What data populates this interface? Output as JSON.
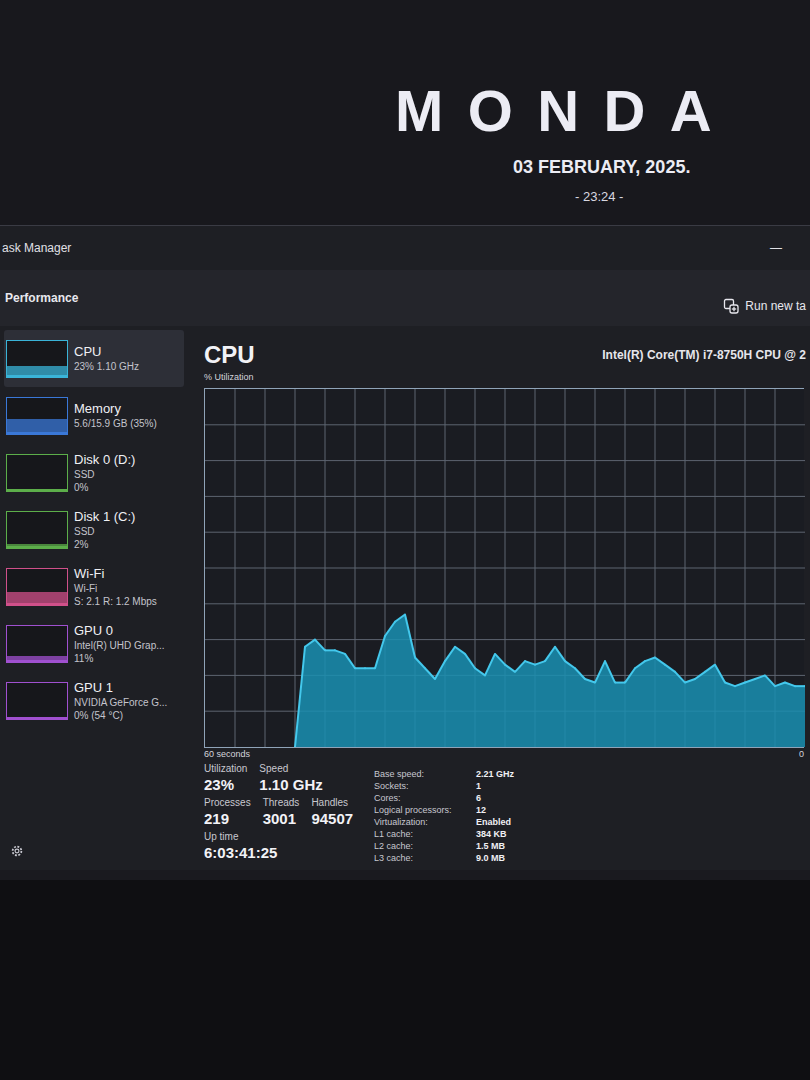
{
  "wallpaper": {
    "day": "MONDA",
    "date": "03 FEBRUARY, 2025.",
    "time": "- 23:24 -"
  },
  "window": {
    "title": "ask Manager",
    "minimize": "—"
  },
  "header": {
    "title": "Performance",
    "action": "Run new ta"
  },
  "sidebar": {
    "items": [
      {
        "name": "CPU",
        "details": [
          "23% 1.10 GHz"
        ],
        "selected": true,
        "level": 0.23,
        "color": "#3ab4d8"
      },
      {
        "name": "Memory",
        "details": [
          "5.6/15.9 GB (35%)"
        ],
        "selected": false,
        "level": 0.35,
        "color": "#3a78d8"
      },
      {
        "name": "Disk 0 (D:)",
        "details": [
          "SSD",
          "0%"
        ],
        "selected": false,
        "level": 0,
        "color": "#5cae4a"
      },
      {
        "name": "Disk 1 (C:)",
        "details": [
          "SSD",
          "2%"
        ],
        "selected": false,
        "level": 0.04,
        "color": "#5cae4a"
      },
      {
        "name": "Wi-Fi",
        "details": [
          "Wi-Fi",
          "S: 2.1 R: 1.2 Mbps"
        ],
        "selected": false,
        "level": 0.3,
        "color": "#d0508a"
      },
      {
        "name": "GPU 0",
        "details": [
          "Intel(R) UHD Grap...",
          "11%"
        ],
        "selected": false,
        "level": 0.11,
        "color": "#a050d0"
      },
      {
        "name": "GPU 1",
        "details": [
          "NVIDIA GeForce G...",
          "0% (54 °C)"
        ],
        "selected": false,
        "level": 0,
        "color": "#a050d0"
      }
    ]
  },
  "main": {
    "title": "CPU",
    "processor": "Intel(R) Core(TM) i7-8750H CPU @ 2",
    "axis_label": "% Utilization",
    "x_start": "60 seconds",
    "x_end": "0",
    "chart": {
      "max": 100,
      "values": [
        0,
        28,
        30,
        27,
        27,
        26,
        22,
        22,
        22,
        31,
        35,
        37,
        25,
        22,
        19,
        24,
        28,
        26,
        22,
        20,
        26,
        23,
        21,
        24,
        23,
        24,
        28,
        24,
        22,
        19,
        18,
        24,
        18,
        18,
        22,
        24,
        25,
        23,
        21,
        18,
        19,
        21,
        23,
        18,
        17,
        18,
        19,
        20,
        17,
        18,
        17,
        17
      ]
    }
  },
  "stats": [
    [
      {
        "label": "Utilization",
        "value": "23%"
      },
      {
        "label": "Speed",
        "value": "1.10 GHz"
      }
    ],
    [
      {
        "label": "Processes",
        "value": "219"
      },
      {
        "label": "Threads",
        "value": "3001"
      },
      {
        "label": "Handles",
        "value": "94507"
      }
    ],
    [
      {
        "label": "Up time",
        "value": "6:03:41:25"
      }
    ]
  ],
  "specs": [
    {
      "label": "Base speed:",
      "value": "2.21 GHz"
    },
    {
      "label": "Sockets:",
      "value": "1"
    },
    {
      "label": "Cores:",
      "value": "6"
    },
    {
      "label": "Logical processors:",
      "value": "12"
    },
    {
      "label": "Virtualization:",
      "value": "Enabled"
    },
    {
      "label": "L1 cache:",
      "value": "384 KB"
    },
    {
      "label": "L2 cache:",
      "value": "1.5 MB"
    },
    {
      "label": "L3 cache:",
      "value": "9.0 MB"
    }
  ]
}
